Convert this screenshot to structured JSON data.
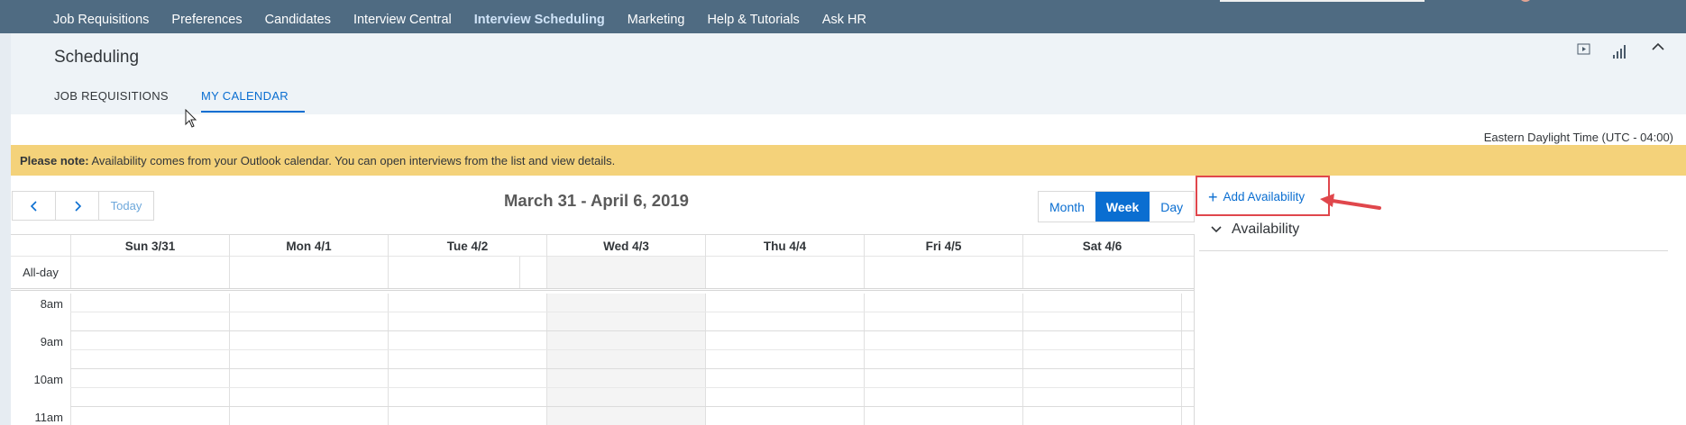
{
  "topnav": {
    "items": [
      "Job Requisitions",
      "Preferences",
      "Candidates",
      "Interview Central",
      "Interview Scheduling",
      "Marketing",
      "Help & Tutorials",
      "Ask HR"
    ],
    "active": "Interview Scheduling"
  },
  "header": {
    "title": "Scheduling",
    "tabs": [
      "JOB REQUISITIONS",
      "MY CALENDAR"
    ],
    "active_tab": "MY CALENDAR",
    "icons": [
      "play-icon",
      "bar-chart-icon",
      "chevron-up-icon"
    ]
  },
  "timezone": "Eastern Daylight Time (UTC - 04:00)",
  "notice": {
    "bold": "Please note:",
    "text": " Availability comes from your Outlook calendar. You can open interviews from the list and view details."
  },
  "toolbar": {
    "today": "Today",
    "week_title": "March 31 - April 6, 2019",
    "views": [
      "Month",
      "Week",
      "Day"
    ],
    "active_view": "Week"
  },
  "availability": {
    "add_label": "Add Availability",
    "section_label": "Availability"
  },
  "calendar": {
    "days": [
      "Sun 3/31",
      "Mon 4/1",
      "Tue 4/2",
      "Wed 4/3",
      "Thu 4/4",
      "Fri 4/5",
      "Sat 4/6"
    ],
    "allday_label": "All-day",
    "times": [
      "8am",
      "9am",
      "10am",
      "11am"
    ]
  },
  "colors": {
    "topbar": "#4f6b82",
    "accent": "#0a6ed1",
    "notice": "#f4d27a",
    "highlight": "#e0474c"
  }
}
